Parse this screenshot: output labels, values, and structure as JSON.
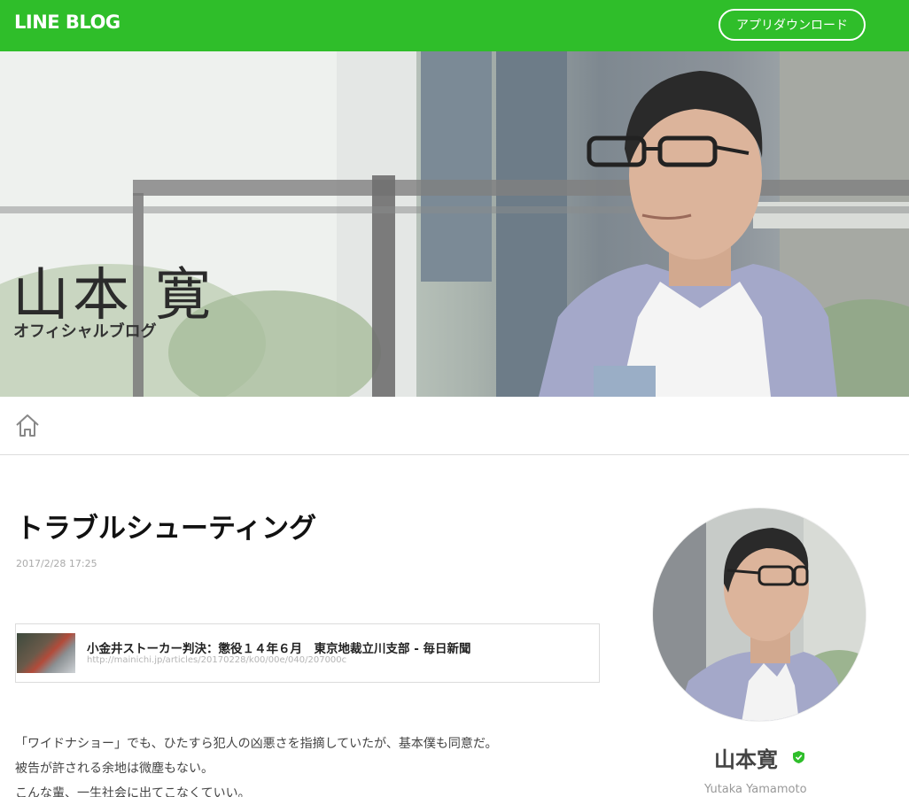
{
  "header": {
    "logo": "LINE BLOG",
    "app_download_label": "アプリダウンロード",
    "brand_color": "#2fbe2a"
  },
  "hero": {
    "title": "山本 寛",
    "subtitle": "オフィシャルブログ"
  },
  "nav": {
    "home_icon": "home-icon"
  },
  "post": {
    "title": "トラブルシューティング",
    "date": "2017/2/28 17:25",
    "link_card": {
      "title": "小金井ストーカー判決：懲役１４年６月　東京地裁立川支部 - 毎日新聞",
      "url": "http://mainichi.jp/articles/20170228/k00/00e/040/207000c"
    },
    "body": [
      "「ワイドナショー」でも、ひたすら犯人の凶悪さを指摘していたが、基本僕も同意だ。",
      "被告が許される余地は微塵もない。",
      "こんな輩、一生社会に出てこなくていい。"
    ]
  },
  "profile": {
    "name": "山本寛",
    "name_en": "Yutaka Yamamoto",
    "verified_icon": "verified-shield-icon",
    "verified_color": "#2fbe2a"
  }
}
